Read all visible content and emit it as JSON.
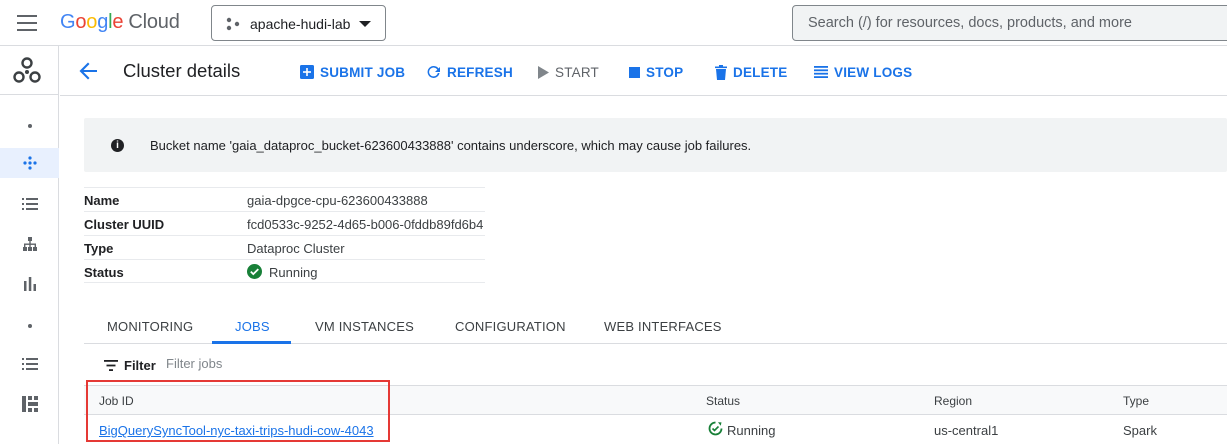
{
  "topbar": {
    "logo_google": "Google",
    "logo_cloud": "Cloud",
    "project_name": "apache-hudi-lab",
    "search_placeholder": "Search (/) for resources, docs, products, and more"
  },
  "header": {
    "title": "Cluster details",
    "actions": {
      "submit_job": "SUBMIT JOB",
      "refresh": "REFRESH",
      "start": "START",
      "stop": "STOP",
      "delete": "DELETE",
      "view_logs": "VIEW LOGS"
    }
  },
  "banner": {
    "icon": "info-icon",
    "message": "Bucket name 'gaia_dataproc_bucket-623600433888' contains underscore, which may cause job failures."
  },
  "details": {
    "rows": [
      {
        "key": "Name",
        "value": "gaia-dpgce-cpu-623600433888"
      },
      {
        "key": "Cluster UUID",
        "value": "fcd0533c-9252-4d65-b006-0fddb89fd6b4"
      },
      {
        "key": "Type",
        "value": "Dataproc Cluster"
      },
      {
        "key": "Status",
        "value": "Running"
      }
    ]
  },
  "tabs": {
    "items": [
      {
        "label": "MONITORING"
      },
      {
        "label": "JOBS"
      },
      {
        "label": "VM INSTANCES"
      },
      {
        "label": "CONFIGURATION"
      },
      {
        "label": "WEB INTERFACES"
      }
    ],
    "active": "JOBS"
  },
  "filter": {
    "label": "Filter",
    "placeholder": "Filter jobs"
  },
  "jobs": {
    "columns": [
      "Job ID",
      "Status",
      "Region",
      "Type"
    ],
    "rows": [
      {
        "job_id": "BigQuerySyncTool-nyc-taxi-trips-hudi-cow-4043",
        "status": "Running",
        "region": "us-central1",
        "type": "Spark"
      }
    ]
  },
  "colors": {
    "accent": "#1a73e8",
    "running": "#188038",
    "highlight": "#e53935"
  }
}
